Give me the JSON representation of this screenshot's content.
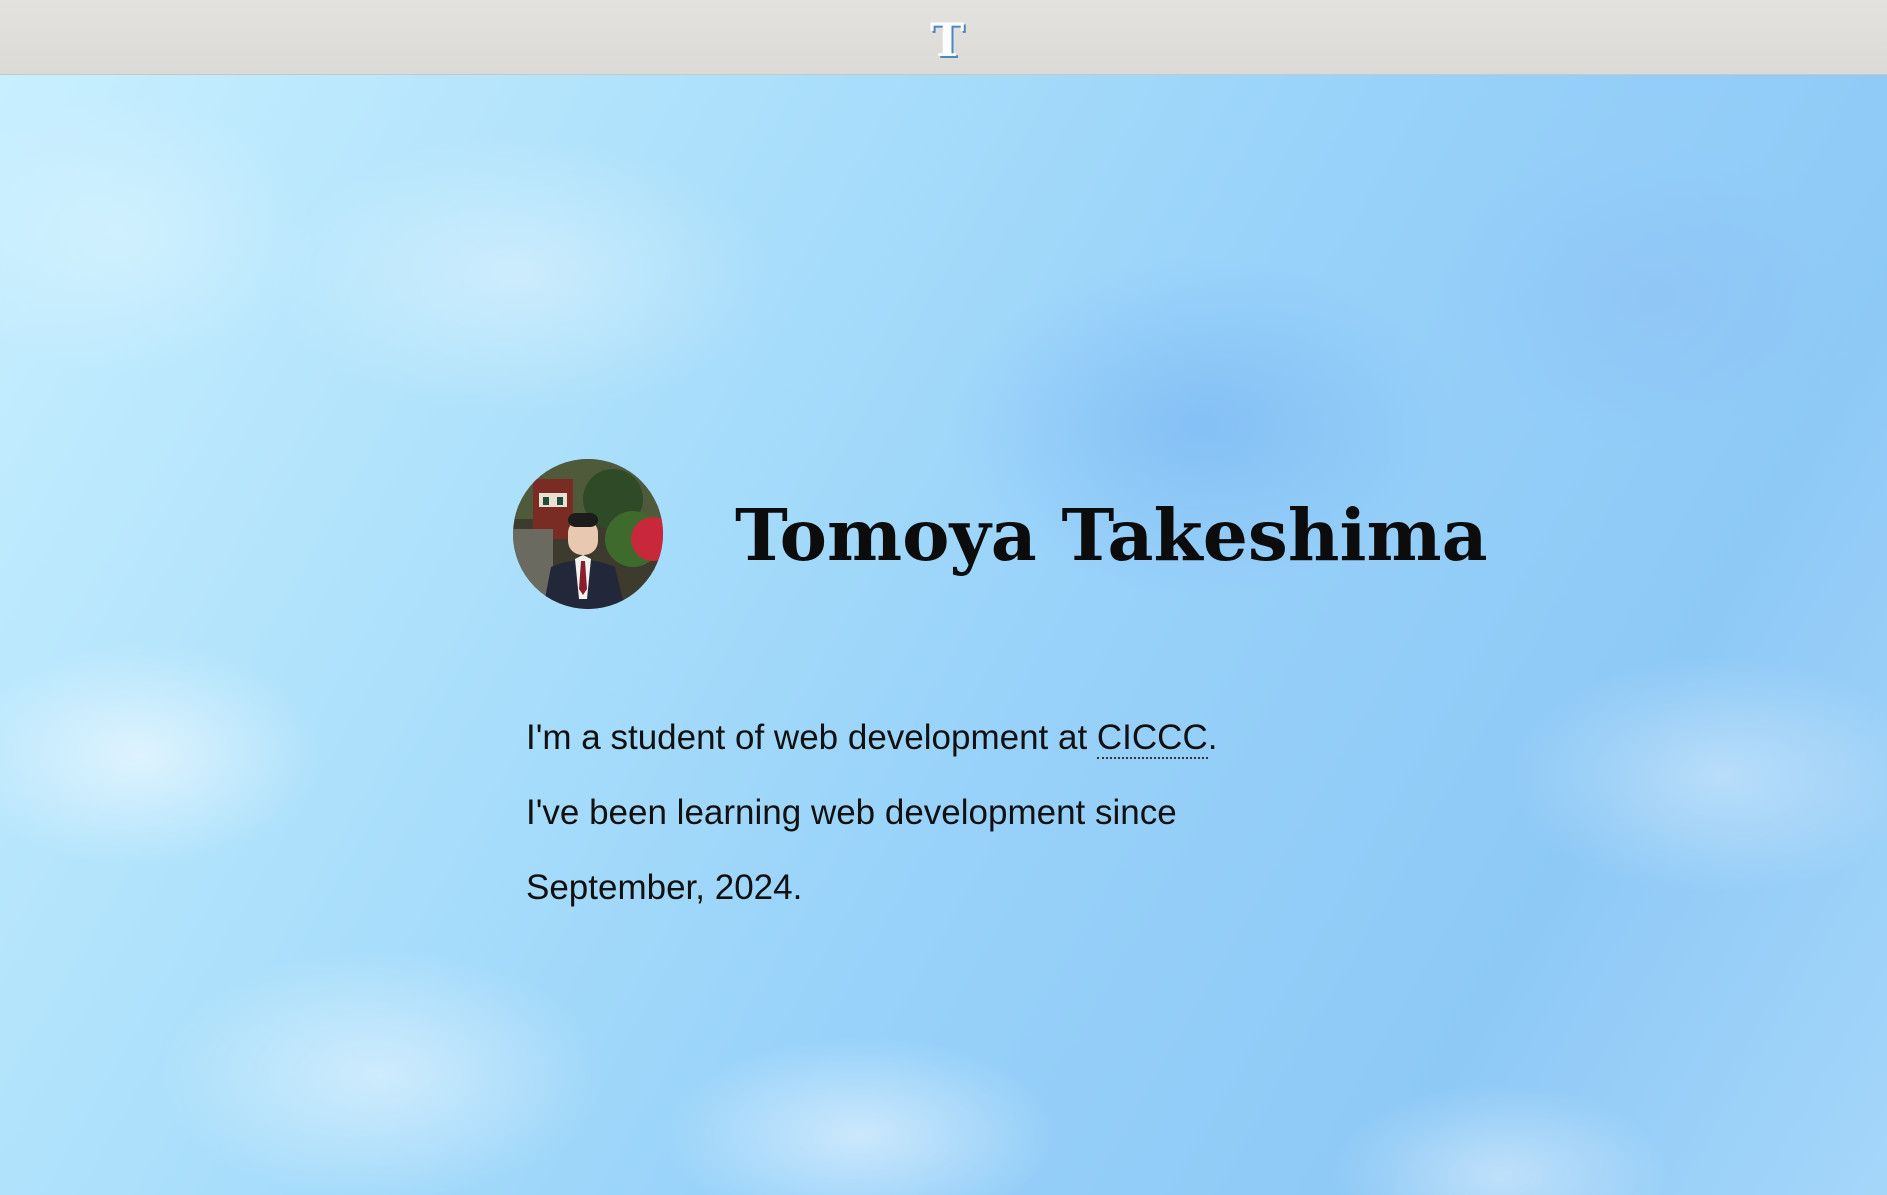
{
  "header": {
    "logo_icon": "letter-t-logo-icon",
    "logo_letter": "T"
  },
  "profile": {
    "name": "Tomoya Takeshima",
    "avatar_icon": "profile-photo"
  },
  "bio": {
    "line1_prefix": "I'm a student of web development at ",
    "school": "CICCC",
    "line1_suffix": ".",
    "line2": "I've been learning web development since September, 2024."
  },
  "theme_toggle": {
    "icon": "moon-icon"
  },
  "colors": {
    "topbar": "#e0dedb",
    "logo_blue": "#4a86c5",
    "sky_light": "#c8efff",
    "sky_mid": "#98d2fa",
    "text": "#0c0c0c"
  }
}
